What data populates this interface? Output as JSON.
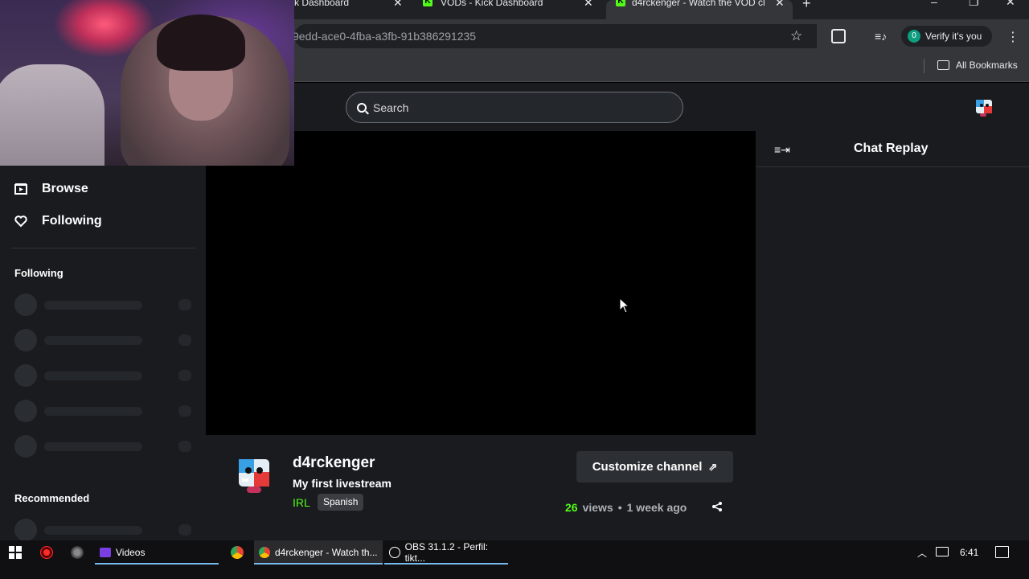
{
  "browser": {
    "tabs": [
      {
        "title": "k Dashboard",
        "close": "✕"
      },
      {
        "title": "VODs - Kick Dashboard",
        "close": "✕"
      },
      {
        "title": "d4rckenger - Watch the VOD cl",
        "close": "✕"
      }
    ],
    "new_tab": "+",
    "url": "9edd-ace0-4fba-a3fb-91b386291235",
    "verify_label": "Verify it's you",
    "verify_avatar_letter": "0",
    "all_bookmarks": "All Bookmarks"
  },
  "kick": {
    "search_placeholder": "Search",
    "sidebar": {
      "nav": [
        {
          "label": "Browse"
        },
        {
          "label": "Following"
        }
      ],
      "following_heading": "Following",
      "recommended_heading": "Recommended"
    },
    "channel": {
      "name": "d4rckenger",
      "stream_title": "My first livestream",
      "category": "IRL",
      "language": "Spanish",
      "customize_label": "Customize channel",
      "views_count": "26",
      "views_label": "views",
      "separator": "•",
      "age": "1 week ago"
    },
    "chat": {
      "title": "Chat Replay"
    },
    "colors": {
      "accent": "#53fc18",
      "background": "#191b1f"
    }
  },
  "taskbar": {
    "apps": [
      {
        "label": "Videos"
      },
      {
        "label": "d4rckenger - Watch th..."
      },
      {
        "label": "OBS 31.1.2 - Perfil: tikt..."
      }
    ],
    "clock": "6:41"
  }
}
